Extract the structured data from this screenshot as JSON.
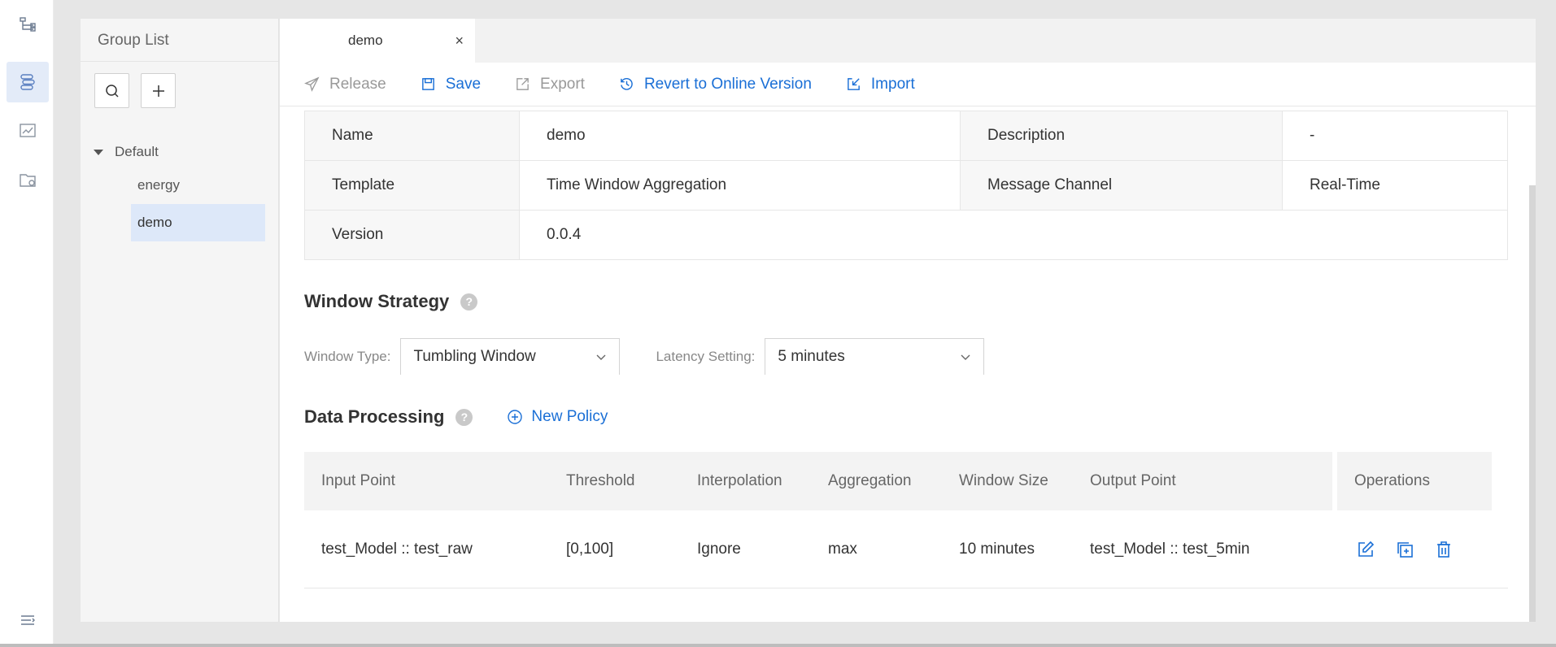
{
  "rail": {
    "items": [
      {
        "icon": "flow-structure-icon",
        "active": false
      },
      {
        "icon": "stream-policy-icon",
        "active": true
      },
      {
        "icon": "monitor-chart-icon",
        "active": false
      },
      {
        "icon": "folder-settings-icon",
        "active": false
      }
    ],
    "bottom_icon": "collapse-menu-icon"
  },
  "group_list": {
    "title": "Group List",
    "tree": {
      "root_label": "Default",
      "items": [
        {
          "label": "energy",
          "selected": false
        },
        {
          "label": "demo",
          "selected": true
        }
      ]
    }
  },
  "tab": {
    "label": "demo",
    "close": "×"
  },
  "toolbar": {
    "release": "Release",
    "save": "Save",
    "export": "Export",
    "revert": "Revert to Online Version",
    "import": "Import"
  },
  "info": {
    "name_label": "Name",
    "name_value": "demo",
    "description_label": "Description",
    "description_value": "-",
    "template_label": "Template",
    "template_value": "Time Window Aggregation",
    "channel_label": "Message Channel",
    "channel_value": "Real-Time",
    "version_label": "Version",
    "version_value": "0.0.4"
  },
  "window_strategy": {
    "title": "Window Strategy",
    "help": "?",
    "window_type_label": "Window Type:",
    "window_type_value": "Tumbling Window",
    "latency_label": "Latency Setting:",
    "latency_value": "5 minutes"
  },
  "data_processing": {
    "title": "Data Processing",
    "help": "?",
    "new_policy": "New Policy",
    "columns": [
      "Input Point",
      "Threshold",
      "Interpolation",
      "Aggregation",
      "Window Size",
      "Output Point"
    ],
    "operations_header": "Operations",
    "rows": [
      [
        "test_Model :: test_raw",
        "[0,100]",
        "Ignore",
        "max",
        "10 minutes",
        "test_Model :: test_5min"
      ]
    ]
  },
  "colors": {
    "accent": "#1a6fd6",
    "selected_bg": "#dde8f9",
    "disabled_text": "#999999"
  }
}
